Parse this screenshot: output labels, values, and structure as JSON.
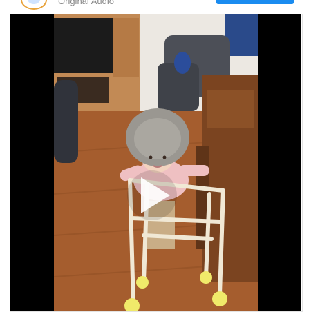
{
  "header": {
    "audio_label": "Original Audio",
    "action_button_label": ""
  },
  "video": {
    "play_icon": "play-icon",
    "accent_color": "#1a8cf0"
  }
}
